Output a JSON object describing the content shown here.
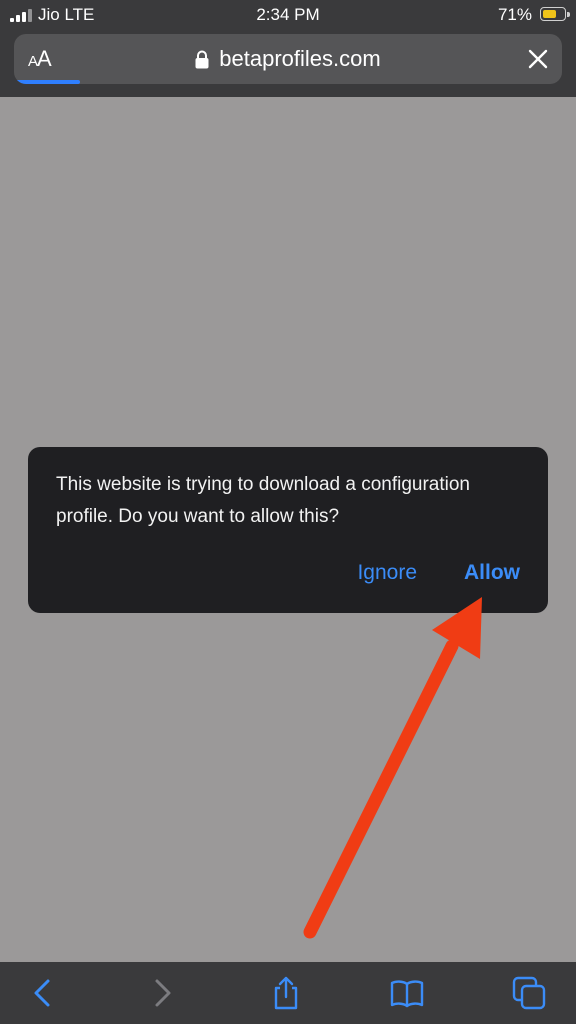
{
  "status_bar": {
    "carrier": "Jio LTE",
    "time": "2:34 PM",
    "battery_percent": "71%",
    "battery_level": 0.71,
    "battery_color": "#f0c419"
  },
  "url_bar": {
    "text_size_label": "AA",
    "text_size_small": "A",
    "text_size_large": "A",
    "url": "betaprofiles.com",
    "lock_icon": "lock-icon",
    "close_icon": "close-icon",
    "load_progress": 0.12,
    "progress_color": "#2f7fff"
  },
  "dialog": {
    "message": "This website is trying to download a configuration profile. Do you want to allow this?",
    "ignore_label": "Ignore",
    "allow_label": "Allow",
    "button_color": "#3b8cf7"
  },
  "annotation": {
    "arrow_color": "#f03c14",
    "arrow_icon": "red-arrow-pointing-to-allow"
  },
  "toolbar": {
    "back_icon": "chevron-left-icon",
    "forward_icon": "chevron-right-icon",
    "share_icon": "share-icon",
    "bookmarks_icon": "book-icon",
    "tabs_icon": "tabs-icon",
    "accent_color": "#3b8cf7"
  }
}
